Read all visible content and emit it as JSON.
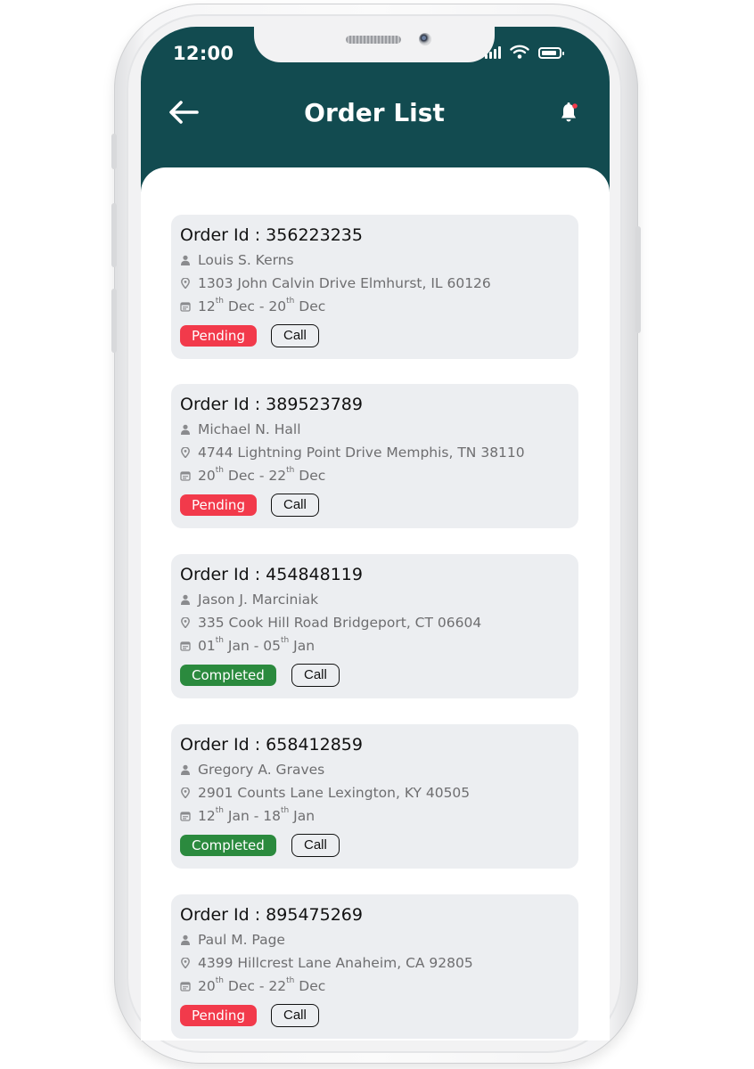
{
  "status_bar": {
    "time": "12:00",
    "signal_icon": "signal-bars-icon",
    "wifi_icon": "wifi-icon",
    "battery_icon": "battery-icon"
  },
  "header": {
    "title": "Order List",
    "back_icon": "arrow-left-icon",
    "notification_icon": "bell-icon",
    "notification_dot_color": "#f23a4b",
    "background_color": "#124b50"
  },
  "orders": [
    {
      "id_label": "Order Id : 356223235",
      "customer": "Louis S. Kerns",
      "address": "1303 John Calvin Drive Elmhurst, IL 60126",
      "date_from_day": "12",
      "date_from_sup": "th",
      "date_from_month": "Dec",
      "date_to_day": "20",
      "date_to_sup": "th",
      "date_to_month": "Dec",
      "status": "Pending",
      "call_label": "Call"
    },
    {
      "id_label": "Order Id : 389523789",
      "customer": "Michael N. Hall",
      "address": "4744 Lightning Point Drive Memphis, TN 38110",
      "date_from_day": "20",
      "date_from_sup": "th",
      "date_from_month": "Dec",
      "date_to_day": "22",
      "date_to_sup": "th",
      "date_to_month": "Dec",
      "status": "Pending",
      "call_label": "Call"
    },
    {
      "id_label": "Order Id : 454848119",
      "customer": "Jason J. Marciniak",
      "address": "335 Cook Hill Road Bridgeport, CT 06604",
      "date_from_day": "01",
      "date_from_sup": "th",
      "date_from_month": "Jan",
      "date_to_day": "05",
      "date_to_sup": "th",
      "date_to_month": "Jan",
      "status": "Completed",
      "call_label": "Call"
    },
    {
      "id_label": "Order Id : 658412859",
      "customer": "Gregory A. Graves",
      "address": "2901 Counts Lane Lexington, KY 40505",
      "date_from_day": "12",
      "date_from_sup": "th",
      "date_from_month": "Jan",
      "date_to_day": "18",
      "date_to_sup": "th",
      "date_to_month": "Jan",
      "status": "Completed",
      "call_label": "Call"
    },
    {
      "id_label": "Order Id : 895475269",
      "customer": "Paul M. Page",
      "address": "4399 Hillcrest Lane Anaheim, CA 92805",
      "date_from_day": "20",
      "date_from_sup": "th",
      "date_from_month": "Dec",
      "date_to_day": "22",
      "date_to_sup": "th",
      "date_to_month": "Dec",
      "status": "Pending",
      "call_label": "Call"
    }
  ],
  "icons": {
    "customer": "person-icon",
    "address": "location-pin-icon",
    "date": "calendar-icon"
  },
  "colors": {
    "pending": "#f23a4b",
    "completed": "#2b8a3e",
    "card_background": "#eceef1"
  }
}
